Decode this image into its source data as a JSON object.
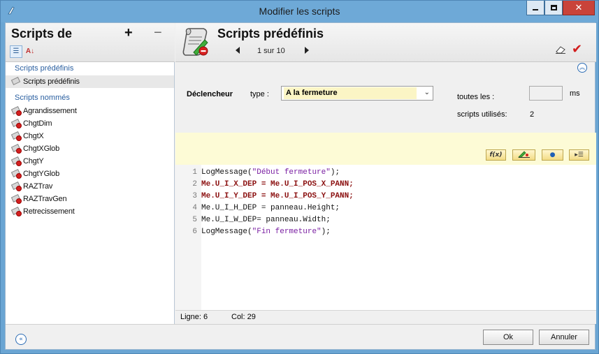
{
  "window": {
    "title": "Modifier les scripts",
    "buttons": {
      "minimize": "minimize-icon",
      "maximize": "maximize-icon",
      "close": "x"
    }
  },
  "left_panel": {
    "title": "Scripts de",
    "add_label": "+",
    "remove_label": "−",
    "sections": [
      {
        "label": "Scripts prédéfinis",
        "items": [
          {
            "label": "Scripts prédéfinis",
            "selected": true
          }
        ]
      },
      {
        "label": "Scripts nommés",
        "items": [
          {
            "label": "Agrandissement"
          },
          {
            "label": "ChgtDim"
          },
          {
            "label": "ChgtX"
          },
          {
            "label": "ChgtXGlob"
          },
          {
            "label": "ChgtY"
          },
          {
            "label": "ChgtYGlob"
          },
          {
            "label": "RAZTrav"
          },
          {
            "label": "RAZTravGen"
          },
          {
            "label": "Retrecissement"
          }
        ]
      }
    ]
  },
  "header": {
    "title": "Scripts prédéfinis",
    "pager": "1 sur 10"
  },
  "trigger": {
    "label": "Déclencheur",
    "type_label": "type :",
    "type_value": "A la fermeture",
    "interval_label": "toutes les :",
    "interval_value": "",
    "interval_unit": "ms",
    "used_label": "scripts utilisés:",
    "used_value": "2"
  },
  "toolbar": {
    "fx_label": "f(x)",
    "rules_icon": "ruler-icon",
    "blob_icon": "object-icon",
    "list_icon": "list-icon"
  },
  "editor": {
    "lines": [
      {
        "n": "1",
        "text": "LogMessage(\"Début fermeture\");"
      },
      {
        "n": "2",
        "text": "Me.U_I_X_DEP = Me.U_I_POS_X_PANN;"
      },
      {
        "n": "3",
        "text": "Me.U_I_Y_DEP = Me.U_I_POS_Y_PANN;"
      },
      {
        "n": "4",
        "text": "Me.U_I_H_DEP = panneau.Height;"
      },
      {
        "n": "5",
        "text": "Me.U_I_W_DEP= panneau.Width;"
      },
      {
        "n": "6",
        "text": "LogMessage(\"Fin fermeture\");"
      }
    ]
  },
  "status": {
    "line_label": "Ligne:",
    "line_value": "6",
    "col_label": "Col:",
    "col_value": "29"
  },
  "footer": {
    "ok_label": "Ok",
    "cancel_label": "Annuler"
  }
}
